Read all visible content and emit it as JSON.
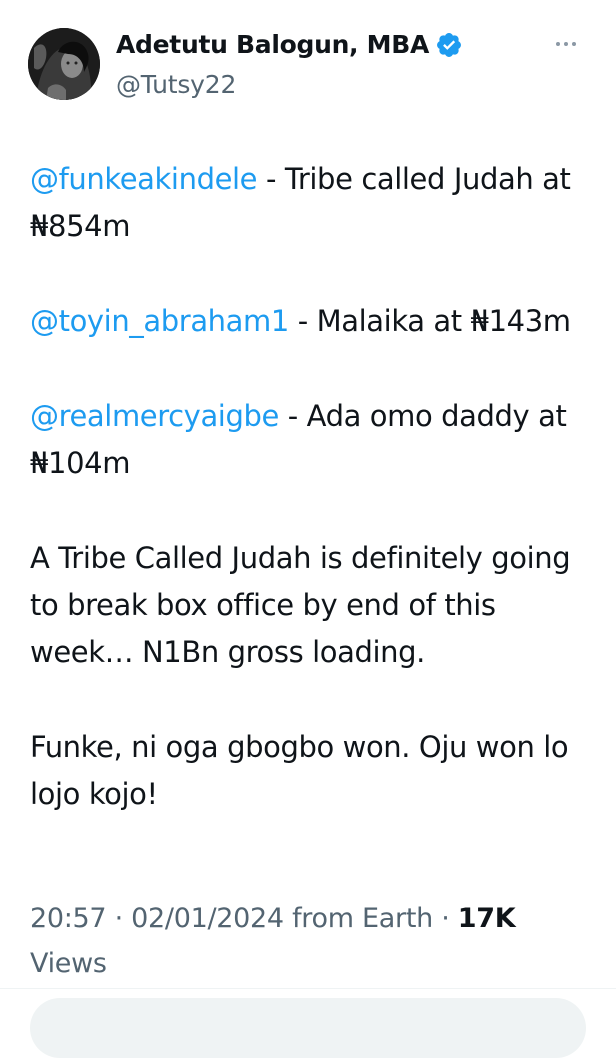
{
  "author": {
    "display_name": "Adetutu Balogun, MBA",
    "handle": "@Tutsy22",
    "verified": true,
    "verified_color": "#1d9bf0"
  },
  "tweet": {
    "lines": [
      {
        "mention": "@funkeakindele",
        "text": " - Tribe called Judah at ₦854m"
      },
      {
        "mention": "@toyin_abraham1",
        "text": " - Malaika at ₦143m"
      },
      {
        "mention": "@realmercyaigbe",
        "text": " - Ada omo daddy at ₦104m"
      }
    ],
    "paragraph_4": "A Tribe Called Judah is definitely going to break box office by end of this week… N1Bn gross loading.",
    "paragraph_5": "Funke, ni oga gbogbo won. Oju won lo lojo kojo!"
  },
  "meta": {
    "time": "20:57",
    "date": "02/01/2024",
    "source": "from Earth",
    "views_count": "17K",
    "views_label": "Views"
  },
  "icons": {
    "more": "more-dots-icon",
    "verified": "verified-badge-icon"
  },
  "colors": {
    "mention": "#1d9bf0",
    "secondary_text": "#536471",
    "primary_text": "#0f1419"
  }
}
